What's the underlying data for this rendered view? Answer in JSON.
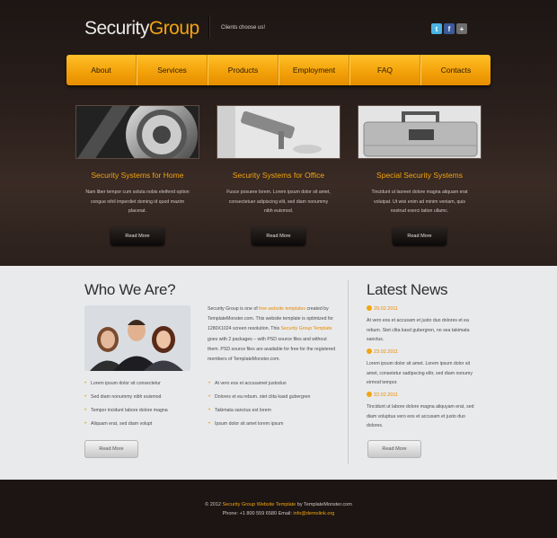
{
  "header": {
    "logo_part1": "Security",
    "logo_part2": "Group",
    "tagline": "Clients choose us!",
    "social": [
      "twitter-icon",
      "facebook-icon",
      "google-plus-icon"
    ]
  },
  "nav": [
    "About",
    "Services",
    "Products",
    "Employment",
    "FAQ",
    "Contacts"
  ],
  "features": [
    {
      "title": "Security Systems for Home",
      "text": "Nam liber tempor cum soluta nobis eleifend option congue nihil imperdiet doming id quod mazim placerat.",
      "button": "Read More",
      "image": "vault-dial"
    },
    {
      "title": "Security Systems for Office",
      "text": "Fusce posuere lorem. Lorem ipsum dolor sit amet, consectetuer adipiscing elit, sed diam nonummy nibh euismod.",
      "button": "Read More",
      "image": "security-camera"
    },
    {
      "title": "Special Security Systems",
      "text": "Tincidunt ut laoreet dolore magna aliquam erat volutpat. Ut wisi enim ad minim veniam, quis nostrud exerci tation ullamc.",
      "button": "Read More",
      "image": "metal-case"
    }
  ],
  "about": {
    "heading": "Who We Are?",
    "text_a": "Security Group is one of ",
    "link_a": "free website templates",
    "text_b": " created by TemplateMonster.com. This website template is optimized for 1280X1024 screen resolution. This ",
    "link_b": "Security Group Template",
    "text_c": " goes with 2 packages – with PSD source files and without them. PSD source files are available for free for the registered members of TemplateMonster.com.",
    "bullets_left": [
      "Lorem ipsum dolor sit consectetur",
      "Sed diam nonummy nibh euismod",
      "Tempor incidunt labore dolore magna",
      "Aliquam erat, sed diam volupt"
    ],
    "bullets_right": [
      "At vero eos et accusamet justoduo",
      "Dolores et ea rebum. stet clita kasd gubergren",
      "Takimata sanctus est lorem",
      "Ipsum dolor sit amet lorem ipsum"
    ],
    "button": "Read More"
  },
  "news": {
    "heading": "Latest News",
    "items": [
      {
        "date": "29.02.2011",
        "text": "At vero eos et accusam et justo duo dolores et ea rebum. Stet clita kasd gubergren, no sea takimata sanctus."
      },
      {
        "date": "23.02.2011",
        "text": "Lorem ipsum dolor sit amet. Lorem ipsum dolor sit amet, consetetur sadipscing elitr, sed diam nonumy eirmod tempor."
      },
      {
        "date": "22.02.2011",
        "text": "Tincidunt ut labore dolore magna aliquyam erat, sed diam voluptua vero eos et accusam et justo duo dolores."
      }
    ],
    "button": "Read More"
  },
  "footer": {
    "copyright_prefix": "© 2012 ",
    "copyright_link": "Security Group Website Template",
    "copyright_suffix": " by TemplateMonster.com",
    "contact_prefix": "Phone: +1 800 559 6580  Email: ",
    "email": "info@demolink.org"
  }
}
